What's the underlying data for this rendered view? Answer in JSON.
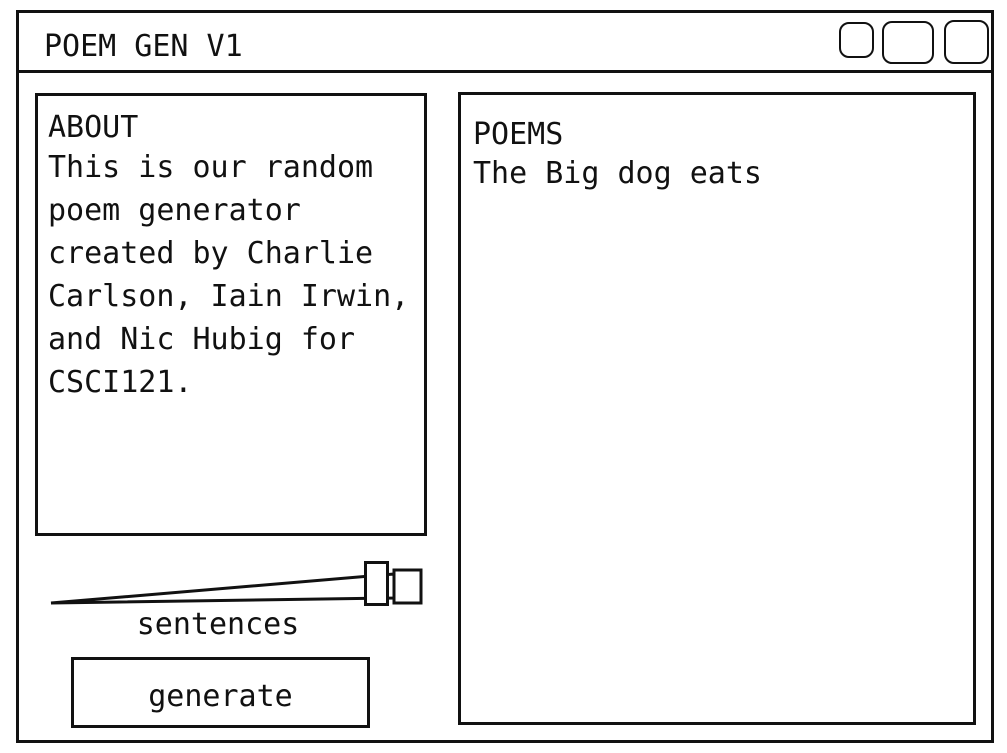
{
  "window": {
    "title": "POEM GEN V1"
  },
  "about": {
    "heading": "ABOUT",
    "text": "This is our random poem generator created by Charlie Carlson, Iain Irwin, and Nic Hubig for CSCI121."
  },
  "controls": {
    "slider_label": "sentences",
    "generate_label": "generate"
  },
  "poems": {
    "heading": "POEMS",
    "lines": [
      "The Big dog eats"
    ]
  }
}
